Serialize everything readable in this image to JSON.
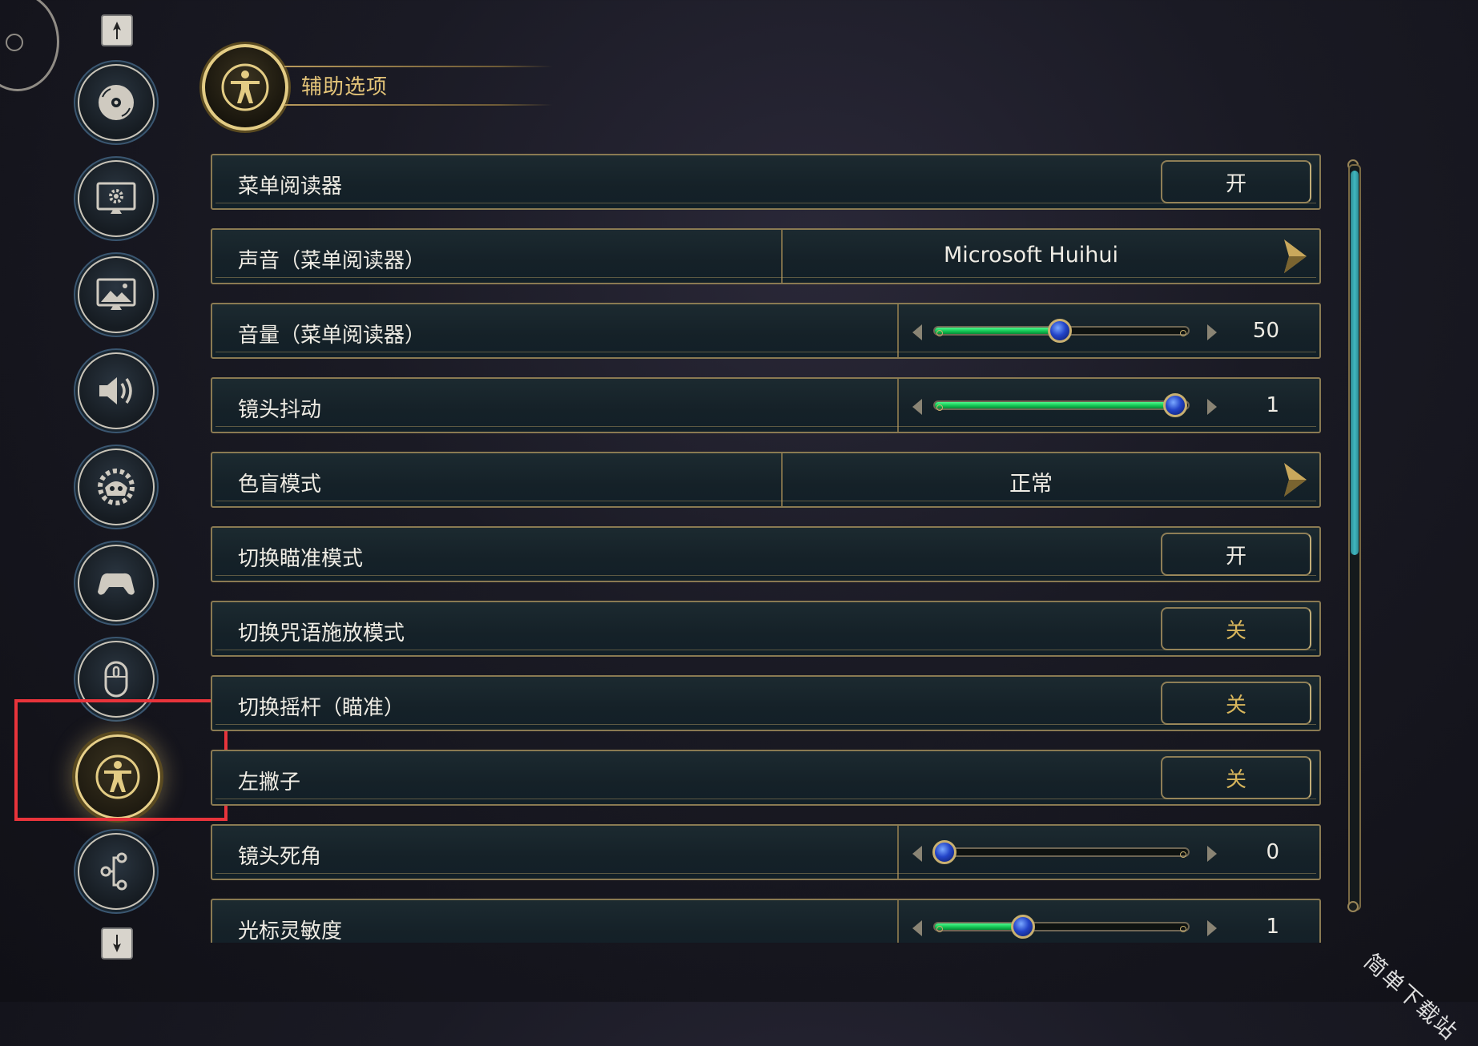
{
  "header": {
    "title": "辅助选项",
    "emblem_icon": "accessibility-icon"
  },
  "sidebar": {
    "scroll_up_icon": "arrow-up-icon",
    "scroll_down_icon": "arrow-down-icon",
    "items": [
      {
        "icon": "disc-icon",
        "active": false
      },
      {
        "icon": "monitor-gear-icon",
        "active": false
      },
      {
        "icon": "monitor-image-icon",
        "active": false
      },
      {
        "icon": "speaker-icon",
        "active": false
      },
      {
        "icon": "gear-helmet-icon",
        "active": false
      },
      {
        "icon": "gamepad-icon",
        "active": false
      },
      {
        "icon": "mouse-icon",
        "active": false
      },
      {
        "icon": "accessibility-icon",
        "active": true
      },
      {
        "icon": "network-icon",
        "active": false
      }
    ]
  },
  "settings": [
    {
      "label": "菜单阅读器",
      "type": "toggle",
      "value": "开"
    },
    {
      "label": "声音（菜单阅读器）",
      "type": "select",
      "value": "Microsoft Huihui"
    },
    {
      "label": "音量（菜单阅读器）",
      "type": "slider",
      "value": "50",
      "fraction": 0.5
    },
    {
      "label": "镜头抖动",
      "type": "slider",
      "value": "1",
      "fraction": 1.0
    },
    {
      "label": "色盲模式",
      "type": "select",
      "value": "正常"
    },
    {
      "label": "切换瞄准模式",
      "type": "toggle",
      "value": "开"
    },
    {
      "label": "切换咒语施放模式",
      "type": "toggle",
      "value": "关"
    },
    {
      "label": "切换摇杆（瞄准）",
      "type": "toggle",
      "value": "关"
    },
    {
      "label": "左撇子",
      "type": "toggle",
      "value": "关"
    },
    {
      "label": "镜头死角",
      "type": "slider",
      "value": "0",
      "fraction": 0.0
    },
    {
      "label": "光标灵敏度",
      "type": "slider",
      "value": "1",
      "fraction": 0.34
    }
  ],
  "colors": {
    "accent_gold": "#e5c579",
    "slider_green": "#10c050",
    "highlight_red": "#e8343b",
    "scroll_teal": "#3fb7c0"
  },
  "watermark": "简单下载站"
}
